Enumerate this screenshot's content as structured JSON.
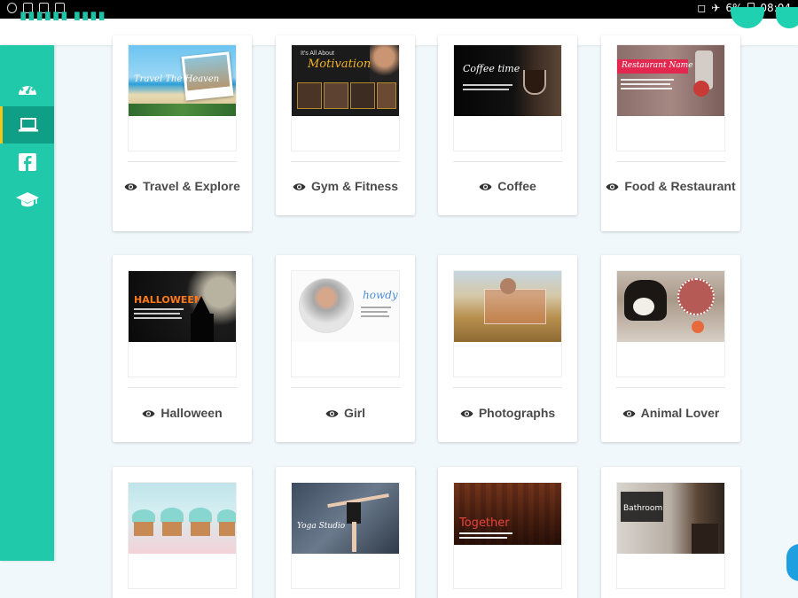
{
  "status_bar": {
    "battery": "6%",
    "time": "08:04"
  },
  "sidebar": {
    "items": [
      {
        "name": "dashboard",
        "icon": "dashboard-icon"
      },
      {
        "name": "laptop",
        "icon": "laptop-icon"
      },
      {
        "name": "facebook",
        "icon": "facebook-icon"
      },
      {
        "name": "graduation",
        "icon": "graduation-cap-icon"
      }
    ]
  },
  "colors": {
    "accent": "#1fc9a9",
    "active": "#0e9f86",
    "indicator": "#f5c518"
  },
  "templates": [
    {
      "label": "Travel & Explore",
      "thumb_text": "Travel The Heaven"
    },
    {
      "label": "Gym & Fitness",
      "thumb_text": "Motivation"
    },
    {
      "label": "Coffee",
      "thumb_text": "Coffee time"
    },
    {
      "label": "Food & Restaurant",
      "thumb_text": "Restaurant Name"
    },
    {
      "label": "Halloween",
      "thumb_text": "HALLOWEEN"
    },
    {
      "label": "Girl",
      "thumb_text": "howdy"
    },
    {
      "label": "Photographs",
      "thumb_text": ""
    },
    {
      "label": "Animal Lover",
      "thumb_text": ""
    },
    {
      "label": "",
      "thumb_text": ""
    },
    {
      "label": "",
      "thumb_text": "Yoga Studio"
    },
    {
      "label": "",
      "thumb_text": "Together"
    },
    {
      "label": "",
      "thumb_text": "Bathroom"
    }
  ]
}
